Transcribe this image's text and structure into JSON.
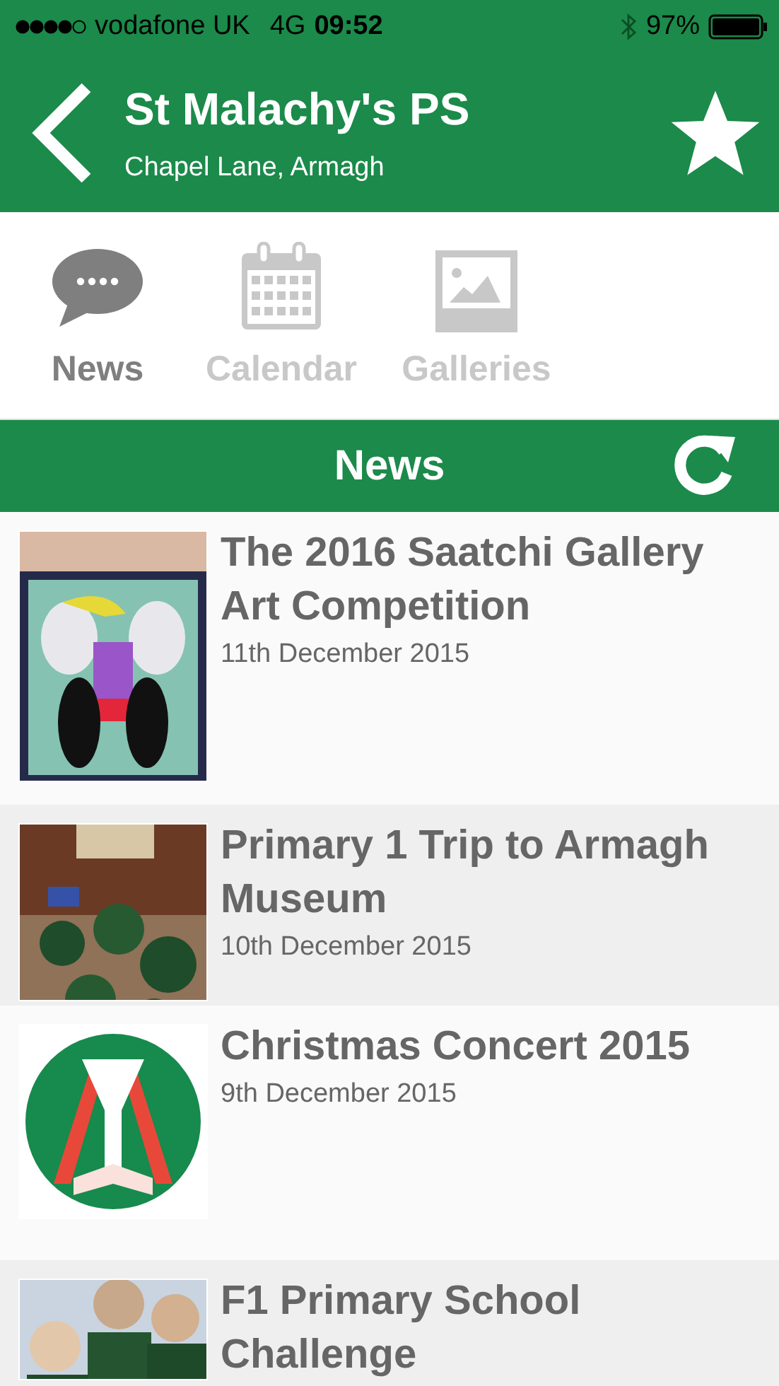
{
  "status_bar": {
    "carrier": "vodafone UK",
    "network": "4G",
    "time": "09:52",
    "battery": "97%"
  },
  "header": {
    "title": "St Malachy's PS",
    "subtitle": "Chapel Lane, Armagh"
  },
  "tabs": [
    {
      "label": "News",
      "selected": true,
      "kind": "news"
    },
    {
      "label": "Calendar",
      "selected": false,
      "kind": "calendar"
    },
    {
      "label": "Galleries",
      "selected": false,
      "kind": "galleries"
    }
  ],
  "section": {
    "title": "News"
  },
  "news": [
    {
      "title": "The 2016 Saatchi Gallery Art Competition",
      "date": "11th December 2015"
    },
    {
      "title": "Primary 1 Trip to Armagh Museum",
      "date": "10th December 2015"
    },
    {
      "title": "Christmas Concert 2015",
      "date": "9th December 2015"
    },
    {
      "title": "F1 Primary School Challenge"
    }
  ]
}
